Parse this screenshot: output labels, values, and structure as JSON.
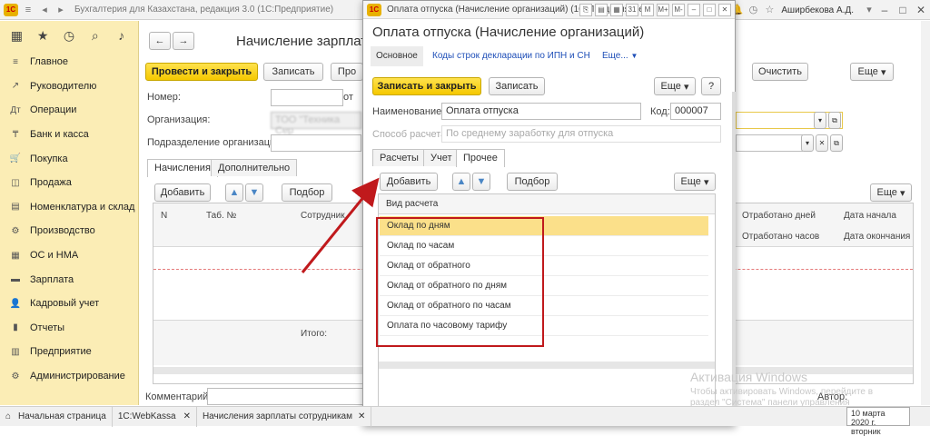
{
  "app": {
    "title": "Бухгалтерия для Казахстана, редакция 3.0  (1С:Предприятие)",
    "user": "Аширбекова А.Д."
  },
  "sidebar": {
    "items": [
      {
        "label": "Главное",
        "icon": "≡"
      },
      {
        "label": "Руководителю",
        "icon": "↗"
      },
      {
        "label": "Операции",
        "icon": "Дт"
      },
      {
        "label": "Банк и касса",
        "icon": "₸"
      },
      {
        "label": "Покупка",
        "icon": "🛒"
      },
      {
        "label": "Продажа",
        "icon": "◫"
      },
      {
        "label": "Номенклатура и склад",
        "icon": "▤"
      },
      {
        "label": "Производство",
        "icon": "⚙"
      },
      {
        "label": "ОС и НМА",
        "icon": "▦"
      },
      {
        "label": "Зарплата",
        "icon": "▬"
      },
      {
        "label": "Кадровый учет",
        "icon": "👤"
      },
      {
        "label": "Отчеты",
        "icon": "▮"
      },
      {
        "label": "Предприятие",
        "icon": "▥"
      },
      {
        "label": "Администрирование",
        "icon": "⚙"
      }
    ]
  },
  "main": {
    "title": "Начисление зарплаты",
    "btn_post_close": "Провести и закрыть",
    "btn_save": "Записать",
    "btn_pro": "Про",
    "btn_clear": "Очистить",
    "btn_more": "Еще",
    "field_number": "Номер:",
    "field_number_of": "от",
    "field_org": "Организация:",
    "field_org_value": "ТОО \"Техника Сер",
    "field_dept": "Подразделение организации:",
    "tabs": [
      "Начисления",
      "Дополнительно"
    ],
    "btn_add": "Добавить",
    "btn_select": "Подбор",
    "col_n": "N",
    "col_tab": "Таб. №",
    "col_employee": "Сотрудник",
    "col_days": "Отработано дней",
    "col_hours": "Отработано часов",
    "col_start": "Дата начала",
    "col_end": "Дата окончания",
    "total": "Итого:",
    "comment": "Комментарий:",
    "author": "Автор:"
  },
  "dialog": {
    "window_title": "Оплата отпуска (Начисление организаций)  (1С:Предприятие)",
    "title": "Оплата отпуска (Начисление организаций)",
    "nav_main": "Основное",
    "nav_codes": "Коды строк декларации по ИПН и СН",
    "nav_more": "Еще...",
    "btn_save_close": "Записать и закрыть",
    "btn_save": "Записать",
    "btn_more": "Еще",
    "btn_help": "?",
    "name_label": "Наименование:",
    "name_value": "Оплата отпуска",
    "code_label": "Код:",
    "code_value": "000007",
    "calc_label": "Способ расчета:",
    "calc_value": "По среднему заработку для отпуска",
    "tabs": [
      "Расчеты",
      "Учет",
      "Прочее"
    ],
    "btn_add": "Добавить",
    "btn_select": "Подбор",
    "list_header": "Вид расчета",
    "list_items": [
      "Оклад по дням",
      "Оклад по часам",
      "Оклад от обратного",
      "Оклад от обратного по дням",
      "Оклад от обратного по часам",
      "Оплата по часовому тарифу"
    ]
  },
  "taskbar": {
    "items": [
      "Начальная страница",
      "1С:WebKassa",
      "Начисления зарплаты сотрудникам"
    ]
  },
  "windows_watermark": {
    "line1": "Активация Windows",
    "line2": "Чтобы активировать Windows, перейдите в",
    "line3": "раздел \"Система\" панели управления"
  },
  "date": {
    "line1": "10 марта 2020 г.",
    "line2": "вторник"
  },
  "colors": {
    "accent_yellow": "#f5c800",
    "sidebar": "#fbedb5",
    "highlight_border": "#c0191c",
    "selected_row": "#fbe08a"
  }
}
